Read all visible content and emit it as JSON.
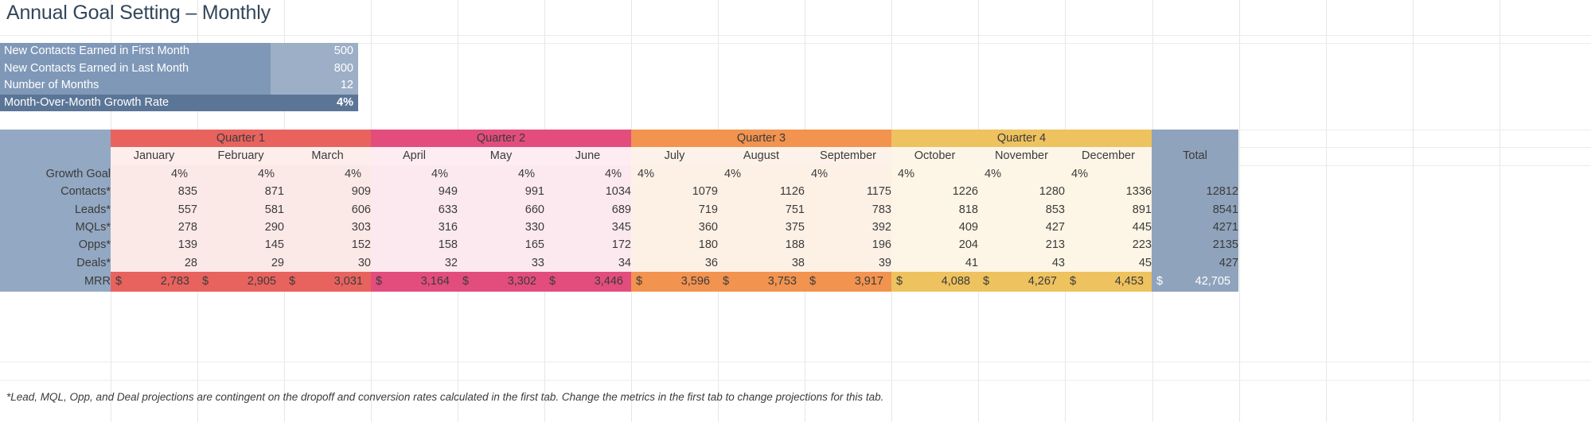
{
  "title": "Annual Goal Setting – Monthly",
  "inputs": [
    {
      "label": "New Contacts Earned in First Month",
      "value": "500"
    },
    {
      "label": "New Contacts Earned in Last Month",
      "value": "800"
    },
    {
      "label": "Number of Months",
      "value": "12"
    },
    {
      "label": "Month-Over-Month Growth Rate",
      "value": "4%"
    }
  ],
  "quarters": [
    {
      "name": "Quarter 1",
      "color": "#e8635e"
    },
    {
      "name": "Quarter 2",
      "color": "#e34d7d"
    },
    {
      "name": "Quarter 3",
      "color": "#f29350"
    },
    {
      "name": "Quarter 4",
      "color": "#eec25f"
    }
  ],
  "total_header": "Total",
  "months": [
    "January",
    "February",
    "March",
    "April",
    "May",
    "June",
    "July",
    "August",
    "September",
    "October",
    "November",
    "December"
  ],
  "row_labels": {
    "growth": "Growth Goal",
    "contacts": "Contacts*",
    "leads": "Leads*",
    "mqls": "MQLs*",
    "opps": "Opps*",
    "deals": "Deals*",
    "mrr": "MRR"
  },
  "currency_symbol": "$",
  "footnote": "*Lead, MQL, Opp, and Deal projections are contingent on the dropoff and conversion rates calculated in the first tab. Change the metrics in the first tab to change projections for this tab.",
  "chart_data": {
    "type": "table",
    "title": "Annual Goal Setting – Monthly",
    "categories": [
      "January",
      "February",
      "March",
      "April",
      "May",
      "June",
      "July",
      "August",
      "September",
      "October",
      "November",
      "December"
    ],
    "series": [
      {
        "name": "Growth Goal",
        "values": [
          "4%",
          "4%",
          "4%",
          "4%",
          "4%",
          "4%",
          "4%",
          "4%",
          "4%",
          "4%",
          "4%",
          "4%"
        ],
        "total": ""
      },
      {
        "name": "Contacts*",
        "values": [
          "835",
          "871",
          "909",
          "949",
          "991",
          "1034",
          "1079",
          "1126",
          "1175",
          "1226",
          "1280",
          "1336"
        ],
        "total": "12812"
      },
      {
        "name": "Leads*",
        "values": [
          "557",
          "581",
          "606",
          "633",
          "660",
          "689",
          "719",
          "751",
          "783",
          "818",
          "853",
          "891"
        ],
        "total": "8541"
      },
      {
        "name": "MQLs*",
        "values": [
          "278",
          "290",
          "303",
          "316",
          "330",
          "345",
          "360",
          "375",
          "392",
          "409",
          "427",
          "445"
        ],
        "total": "4271"
      },
      {
        "name": "Opps*",
        "values": [
          "139",
          "145",
          "152",
          "158",
          "165",
          "172",
          "180",
          "188",
          "196",
          "204",
          "213",
          "223"
        ],
        "total": "2135"
      },
      {
        "name": "Deals*",
        "values": [
          "28",
          "29",
          "30",
          "32",
          "33",
          "34",
          "36",
          "38",
          "39",
          "41",
          "43",
          "45"
        ],
        "total": "427"
      },
      {
        "name": "MRR",
        "values": [
          "2,783",
          "2,905",
          "3,031",
          "3,164",
          "3,302",
          "3,446",
          "3,596",
          "3,753",
          "3,917",
          "4,088",
          "4,267",
          "4,453"
        ],
        "total": "42,705"
      }
    ],
    "xlabel": "",
    "ylabel": "",
    "grid": true,
    "legend": "none"
  }
}
